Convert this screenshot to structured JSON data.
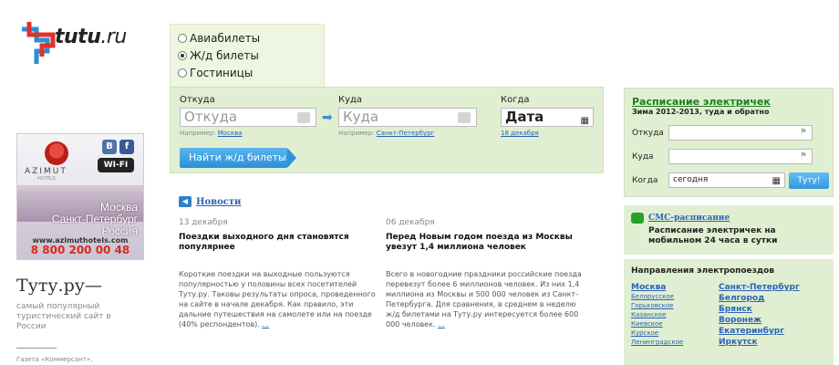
{
  "logo": {
    "brand": "tutu",
    "tld": ".ru"
  },
  "ad": {
    "brand": "AZIMUT",
    "hotels": "HOTELS",
    "wifi": "WI-FI",
    "vk": "B",
    "fb": "f",
    "cities": [
      "Москва",
      "Санкт-Петербург",
      "Россия"
    ],
    "url": "www.azimuthotels.com",
    "phone": "8 800 200 00 48"
  },
  "sidebar": {
    "title": "Туту.ру—",
    "description": "самый популярный туристический сайт в России",
    "quote": "Газета «Коммерсант»,"
  },
  "search": {
    "tabs": [
      "Авиабилеты",
      "Ж/д билеты",
      "Гостиницы"
    ],
    "selected_tab": "Ж/д билеты",
    "from_label": "Откуда",
    "from_placeholder": "Откуда",
    "from_hint_prefix": "Например:",
    "from_hint_link": "Москва",
    "to_label": "Куда",
    "to_placeholder": "Куда",
    "to_hint_prefix": "Например:",
    "to_hint_link": "Санкт-Петербург",
    "when_label": "Когда",
    "when_value": "Дата",
    "when_hint_link": "18 декабря",
    "submit": "Найти ж/д билеты"
  },
  "news": {
    "heading": "Новости",
    "items": [
      {
        "date": "13 декабря",
        "title": "Поездки выходного дня становятся популярнее",
        "text": "Короткие поездки на выходные пользуются популярностью у половины всех посетителей Туту.ру. Таковы результаты опроса, проведенного на сайте в начале декабря. Как правило, эти дальние путешествия на самолете или на поезде (40% респондентов).",
        "more": "..."
      },
      {
        "date": "06 декабря",
        "title": "Перед Новым годом поезда из Москвы увезут 1,4 миллиона человек",
        "text": "Всего в новогодние праздники российские поезда перевезут более 6 миллионов человек. Из них 1,4 миллиона из Москвы и 500 000 человек из Санкт-Петербурга. Для сравнения, в среднем в неделю ж/д билетами на Туту.ру интересуется более 600 000 человек.",
        "more": "..."
      }
    ]
  },
  "schedule": {
    "title": "Расписание электричек",
    "subtitle": "Зима 2012-2013, туда и обратно",
    "from_label": "Откуда",
    "to_label": "Куда",
    "when_label": "Когда",
    "when_value": "сегодня",
    "submit": "Туту!"
  },
  "sms": {
    "link": "СМС-расписание",
    "text": "Расписание электричек на мобильном 24 часа в сутки"
  },
  "directions": {
    "title": "Направления электропоездов",
    "left": [
      "Москва",
      "Белорусское",
      "Горьковское",
      "Казанское",
      "Киевское",
      "Курское",
      "Ленинградское"
    ],
    "right": [
      "Санкт-Петербург",
      "Белгород",
      "Брянск",
      "Воронеж",
      "Екатеринбург",
      "Иркутск"
    ]
  }
}
